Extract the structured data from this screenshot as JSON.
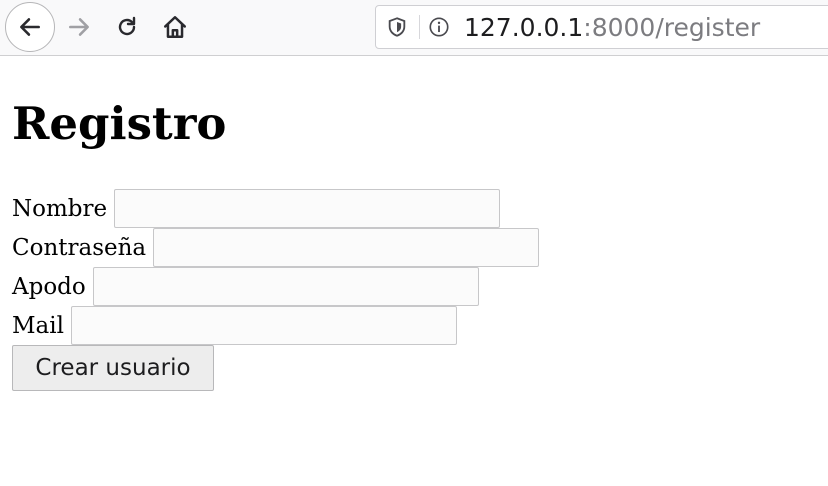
{
  "browser": {
    "url_host": "127.0.0.1",
    "url_path": ":8000/register",
    "icons": {
      "back": "arrow-left",
      "forward": "arrow-right",
      "reload": "reload",
      "home": "home",
      "shield": "tracking-protection-shield",
      "info": "site-information"
    }
  },
  "page": {
    "title": "Registro",
    "fields": [
      {
        "label": "Nombre",
        "value": "",
        "type": "text"
      },
      {
        "label": "Contraseña",
        "value": "",
        "type": "password"
      },
      {
        "label": "Apodo",
        "value": "",
        "type": "text"
      },
      {
        "label": "Mail",
        "value": "",
        "type": "text"
      }
    ],
    "submit_label": "Crear usuario"
  }
}
